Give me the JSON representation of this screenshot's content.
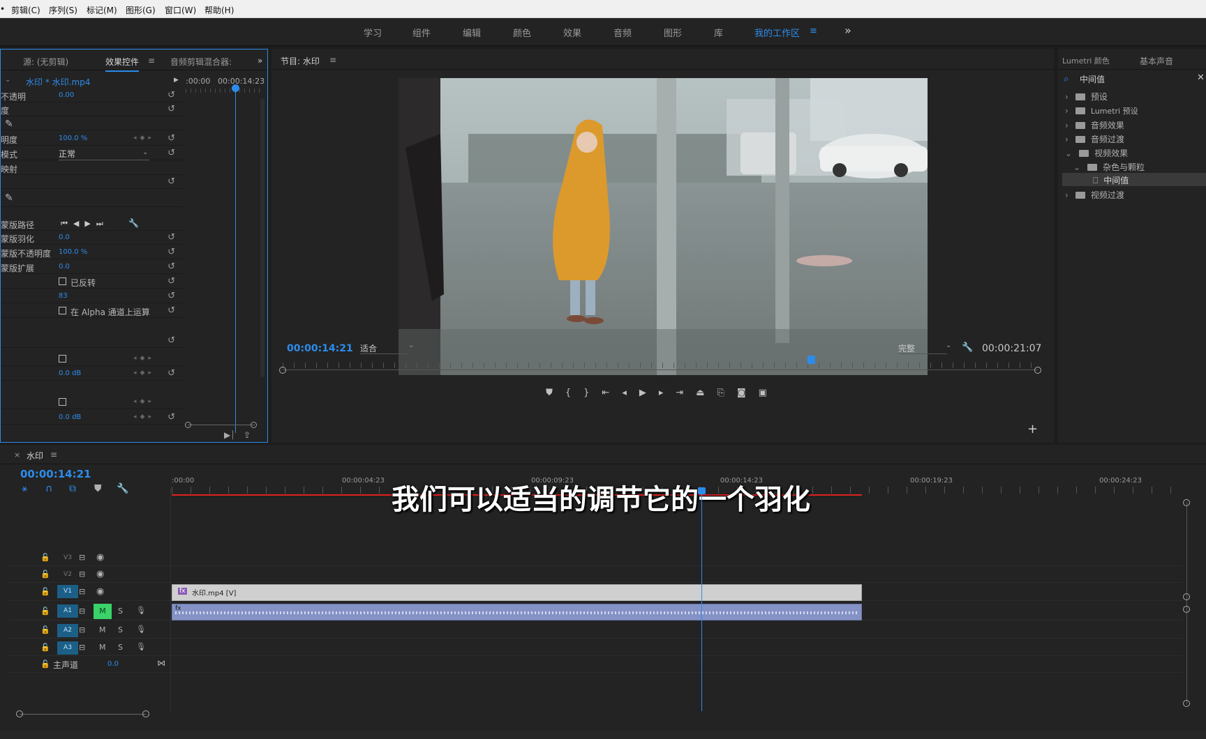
{
  "menu": [
    "剪辑(C)",
    "序列(S)",
    "标记(M)",
    "图形(G)",
    "窗口(W)",
    "帮助(H)"
  ],
  "workspaces": {
    "items": [
      "学习",
      "组件",
      "编辑",
      "颜色",
      "效果",
      "音频",
      "图形",
      "库",
      "我的工作区"
    ],
    "active": "我的工作区",
    "overflow": "»"
  },
  "effect_panel": {
    "tabs": [
      "源: (无剪辑)",
      "效果控件",
      "音频剪辑混合器:"
    ],
    "active_tab": "效果控件",
    "clip_name": "水印 * 水印.mp4",
    "ruler_start": ":00:00",
    "ruler_time": "00:00:14:23",
    "rows": [
      {
        "label": "不透明",
        "value": "0.00"
      },
      {
        "label": "度",
        "value": ""
      },
      {
        "label": "明度",
        "value": "100.0 %"
      },
      {
        "label": "模式",
        "value": "正常"
      },
      {
        "label": "映射",
        "value": ""
      },
      {
        "label": "蒙版路径",
        "value": ""
      },
      {
        "label": "蒙版羽化",
        "value": "0.0"
      },
      {
        "label": "蒙版不透明度",
        "value": "100.0 %"
      },
      {
        "label": "蒙版扩展",
        "value": "0.0"
      },
      {
        "label": "已反转",
        "value": ""
      },
      {
        "label": "",
        "value": "83"
      },
      {
        "label": "在 Alpha 通道上运算",
        "value": ""
      },
      {
        "label": "",
        "value": "0.0 dB"
      },
      {
        "label": "",
        "value": "0.0 dB"
      }
    ]
  },
  "program_monitor": {
    "title": "节目: 水印",
    "timecode": "00:00:14:21",
    "fit": "适合",
    "quality": "完整",
    "duration": "00:00:21:07",
    "playhead_fraction": 0.7
  },
  "right_panel": {
    "tabs": [
      "Lumetri 颜色",
      "基本声音"
    ],
    "search_value": "中间值",
    "tree": [
      {
        "label": "预设",
        "level": 0,
        "expanded": false
      },
      {
        "label": "Lumetri 预设",
        "level": 0,
        "expanded": false
      },
      {
        "label": "音频效果",
        "level": 0,
        "expanded": false
      },
      {
        "label": "音频过渡",
        "level": 0,
        "expanded": false
      },
      {
        "label": "视频效果",
        "level": 0,
        "expanded": true
      },
      {
        "label": "杂色与颗粒",
        "level": 1,
        "expanded": true
      },
      {
        "label": "中间值",
        "level": 2,
        "expanded": false,
        "selected": true
      },
      {
        "label": "视频过渡",
        "level": 0,
        "expanded": false
      }
    ]
  },
  "timeline": {
    "name": "水印",
    "timecode": "00:00:14:21",
    "ruler": [
      ":00:00",
      "00:00:04:23",
      "00:00:09:23",
      "00:00:14:23",
      "00:00:19:23",
      "00:00:24:23"
    ],
    "subtitle": "我们可以适当的调节它的一个羽化",
    "tracks": [
      {
        "name": "V3",
        "type": "video"
      },
      {
        "name": "V2",
        "type": "video"
      },
      {
        "name": "V1",
        "type": "video",
        "targeted": true
      },
      {
        "name": "A1",
        "type": "audio",
        "targeted": true,
        "mute_on": true
      },
      {
        "name": "A2",
        "type": "audio",
        "targeted": true
      },
      {
        "name": "A3",
        "type": "audio",
        "targeted": true
      }
    ],
    "master": {
      "label": "主声道",
      "value": "0.0"
    },
    "video_clip": "水印.mp4 [V]",
    "playhead_fraction": 0.522,
    "work_area_end_fraction": 0.68
  },
  "colors": {
    "accent": "#2d8ceb",
    "panel_bg": "#232323",
    "clip_video": "#cfcfcf",
    "clip_audio": "#8492c5",
    "workarea": "#e02020"
  }
}
